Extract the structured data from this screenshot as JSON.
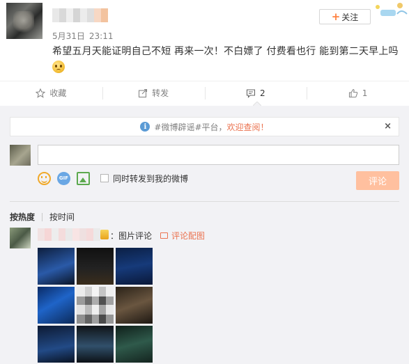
{
  "post": {
    "date": "5月31日",
    "time": "23:11",
    "follow_label": "关注",
    "text": "希望五月天能证明自己不短 再来一次！不白嫖了 付费看也行 能到第二天早上吗",
    "emoji": "sad-face-emoji"
  },
  "actions": [
    {
      "id": "favorite",
      "label": "收藏",
      "icon": "star-icon"
    },
    {
      "id": "repost",
      "label": "转发",
      "icon": "share-icon"
    },
    {
      "id": "comment",
      "label": "2",
      "icon": "comment-icon"
    },
    {
      "id": "like",
      "label": "1",
      "icon": "thumbs-up-icon"
    }
  ],
  "notice": {
    "prefix": "#微博辟谣#平台，",
    "accent": "欢迎查阅！",
    "close": "×"
  },
  "composer": {
    "input_value": "",
    "repost_checkbox_label": "同时转发到我的微博",
    "repost_checked": false,
    "submit_label": "评论"
  },
  "sort": {
    "hot": "按热度",
    "time": "按时间"
  },
  "comment": {
    "text": "：图片评论",
    "link": "评论配图",
    "photo_captions": [
      "",
      "",
      "",
      "",
      "",
      "",
      "",
      "",
      ""
    ]
  },
  "colors": {
    "accent": "#eb7350",
    "submit_disabled": "#ffc09f",
    "background": "#f2f2f5"
  }
}
